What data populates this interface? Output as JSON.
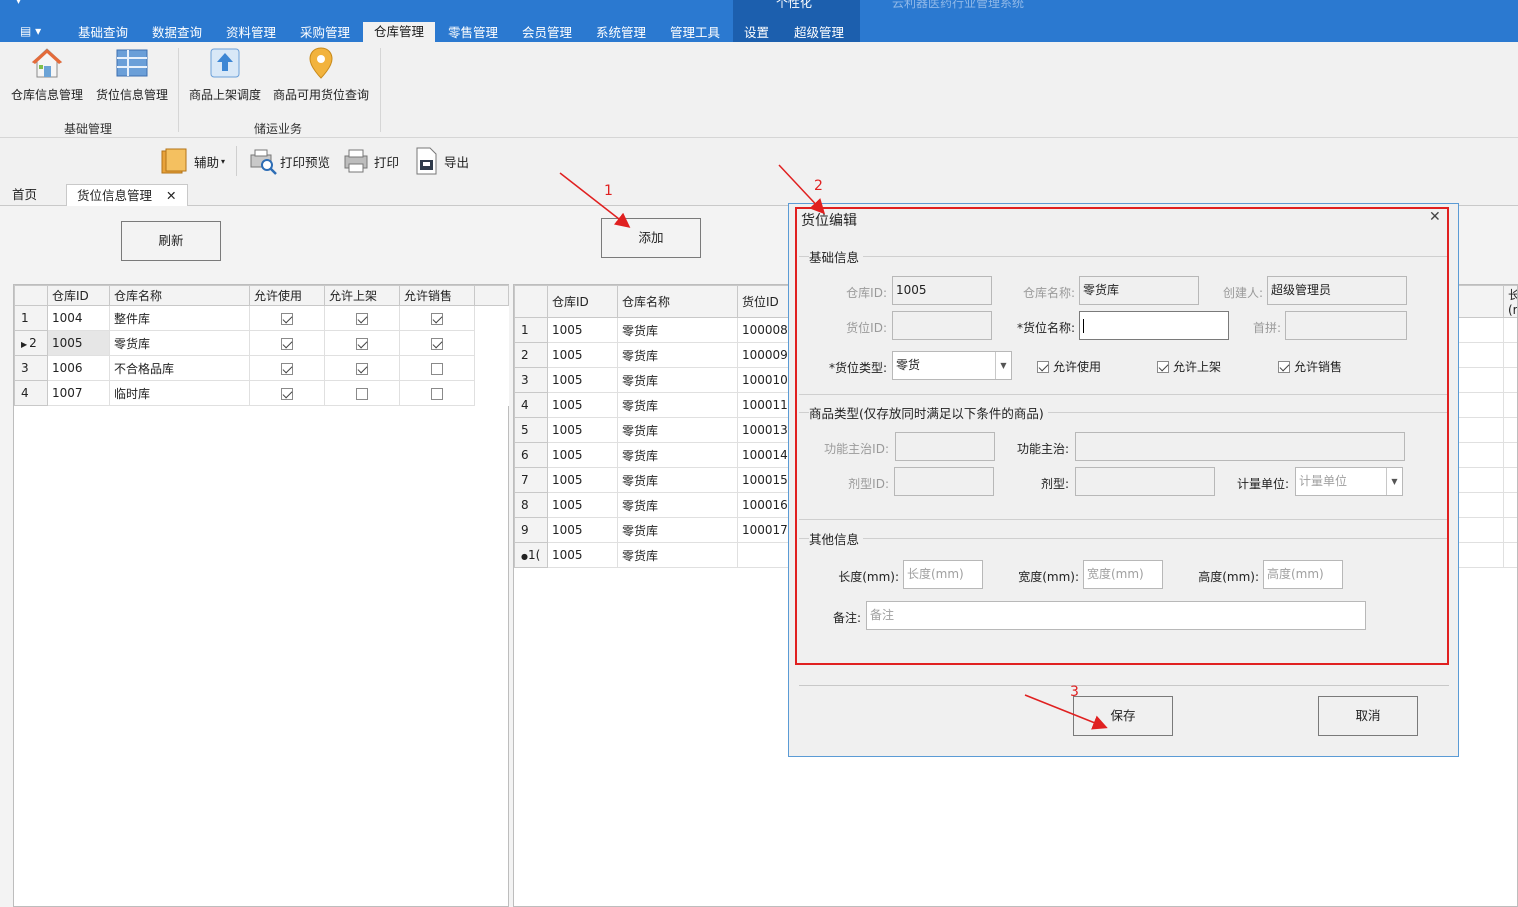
{
  "ribbon": {
    "quick_menu": "▤ ▾",
    "context_label": "个性化",
    "app_title": "云利器医药行业管理系统",
    "tabs": [
      "基础查询",
      "数据查询",
      "资料管理",
      "采购管理",
      "仓库管理",
      "零售管理",
      "会员管理",
      "系统管理",
      "管理工具",
      "设置",
      "超级管理"
    ],
    "active_tab": "仓库管理",
    "buttons": {
      "warehouse_mgmt": "仓库信息管理",
      "location_mgmt": "货位信息管理",
      "shelf_dispatch": "商品上架调度",
      "available_location": "商品可用货位查询"
    },
    "groups": {
      "basic": "基础管理",
      "storage": "储运业务"
    }
  },
  "toolbar": {
    "assist": "辅助",
    "print_preview": "打印预览",
    "print": "打印",
    "export": "导出"
  },
  "doc_tabs": {
    "home": "首页",
    "location": "货位信息管理",
    "close": "✕"
  },
  "buttons": {
    "refresh": "刷新",
    "add": "添加"
  },
  "left_grid": {
    "headers": [
      "仓库ID",
      "仓库名称",
      "允许使用",
      "允许上架",
      "允许销售"
    ],
    "rows": [
      {
        "rn": "1",
        "id": "1004",
        "name": "整件库",
        "use": true,
        "shelf": true,
        "sale": true
      },
      {
        "rn": "2",
        "id": "1005",
        "name": "零货库",
        "use": true,
        "shelf": true,
        "sale": true
      },
      {
        "rn": "3",
        "id": "1006",
        "name": "不合格品库",
        "use": true,
        "shelf": true,
        "sale": false
      },
      {
        "rn": "4",
        "id": "1007",
        "name": "临时库",
        "use": true,
        "shelf": false,
        "sale": false
      }
    ]
  },
  "right_grid": {
    "headers": [
      "仓库ID",
      "仓库名称",
      "货位ID"
    ],
    "extra_header": "长度(r",
    "rows": [
      {
        "rn": "1",
        "wid": "1005",
        "wname": "零货库",
        "lid": "100008"
      },
      {
        "rn": "2",
        "wid": "1005",
        "wname": "零货库",
        "lid": "100009"
      },
      {
        "rn": "3",
        "wid": "1005",
        "wname": "零货库",
        "lid": "100010"
      },
      {
        "rn": "4",
        "wid": "1005",
        "wname": "零货库",
        "lid": "100011"
      },
      {
        "rn": "5",
        "wid": "1005",
        "wname": "零货库",
        "lid": "100013"
      },
      {
        "rn": "6",
        "wid": "1005",
        "wname": "零货库",
        "lid": "100014"
      },
      {
        "rn": "7",
        "wid": "1005",
        "wname": "零货库",
        "lid": "100015"
      },
      {
        "rn": "8",
        "wid": "1005",
        "wname": "零货库",
        "lid": "100016"
      },
      {
        "rn": "9",
        "wid": "1005",
        "wname": "零货库",
        "lid": "100017"
      },
      {
        "rn": "1(",
        "wid": "1005",
        "wname": "零货库",
        "lid": ""
      }
    ]
  },
  "dialog": {
    "title": "货位编辑",
    "close": "✕",
    "basic": {
      "title": "基础信息",
      "warehouse_id_label": "仓库ID:",
      "warehouse_id": "1005",
      "warehouse_name_label": "仓库名称:",
      "warehouse_name": "零货库",
      "creator_label": "创建人:",
      "creator": "超级管理员",
      "location_id_label": "货位ID:",
      "location_name_label": "*货位名称:",
      "pinyin_label": "首拼:",
      "location_type_label": "*货位类型:",
      "location_type": "零货",
      "allow_use": "允许使用",
      "allow_shelf": "允许上架",
      "allow_sale": "允许销售"
    },
    "goods": {
      "title": "商品类型(仅存放同时满足以下条件的商品)",
      "func_id_label": "功能主治ID:",
      "func_label": "功能主治:",
      "form_id_label": "剂型ID:",
      "form_label": "剂型:",
      "unit_label": "计量单位:",
      "unit_placeholder": "计量单位"
    },
    "other": {
      "title": "其他信息",
      "length_label": "长度(mm):",
      "length_placeholder": "长度(mm)",
      "width_label": "宽度(mm):",
      "width_placeholder": "宽度(mm)",
      "height_label": "高度(mm):",
      "height_placeholder": "高度(mm)",
      "note_label": "备注:",
      "note_placeholder": "备注"
    },
    "save": "保存",
    "cancel": "取消"
  },
  "annotations": {
    "n1": "1",
    "n2": "2",
    "n3": "3"
  },
  "colors": {
    "ribbon_blue": "#2b79d0",
    "annotation_red": "#e02020",
    "dialog_border": "#5b9bd5"
  }
}
